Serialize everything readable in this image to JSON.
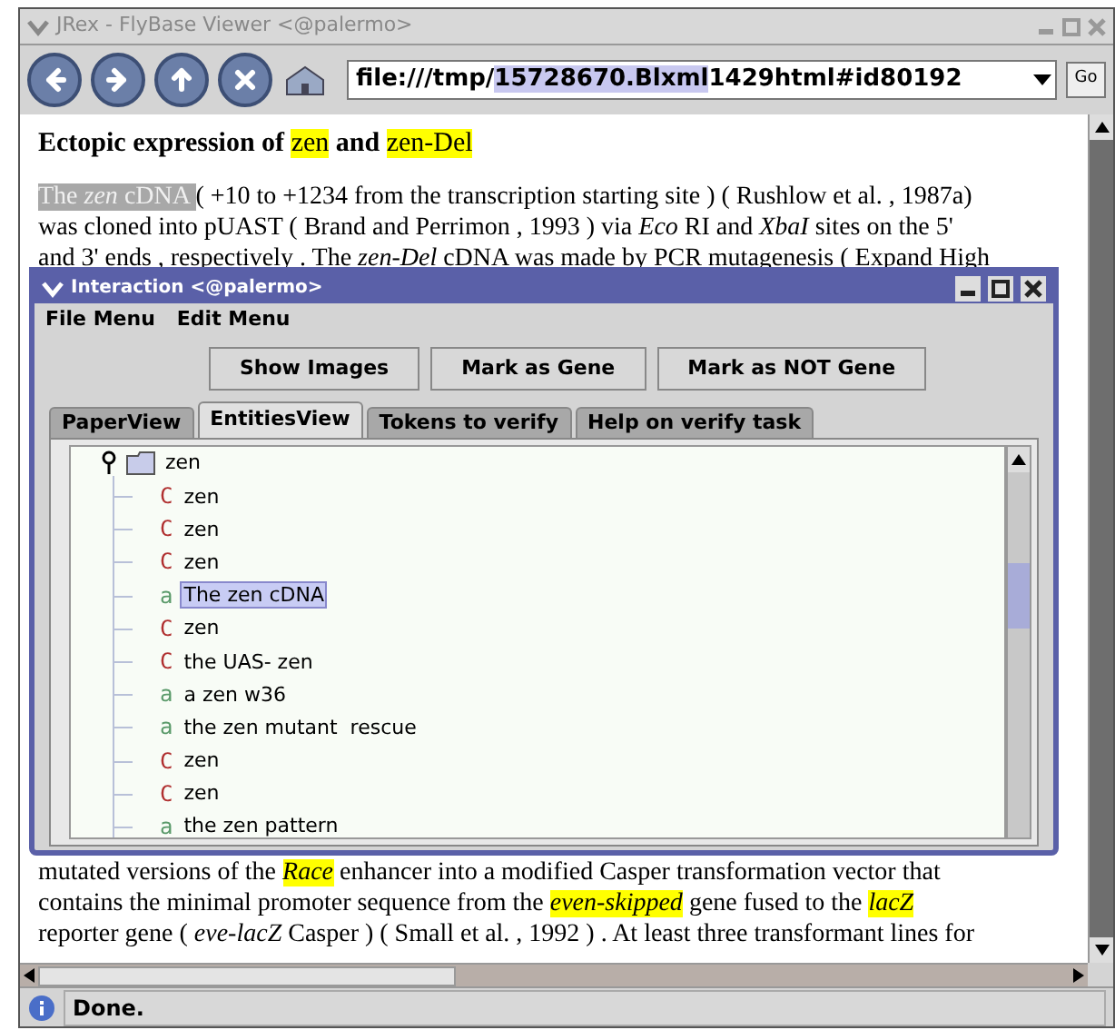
{
  "window": {
    "title": "JRex - FlyBase Viewer <@palermo>"
  },
  "address": {
    "parts": [
      {
        "text": "file:///tmp/",
        "selected": false
      },
      {
        "text": "15728670.Blxml",
        "selected": true
      },
      {
        "text": "1429html#id80192",
        "selected": false
      }
    ],
    "go": "Go"
  },
  "heading": [
    {
      "text": "Ectopic expression of ",
      "bold": true,
      "highlight": false
    },
    {
      "text": "zen",
      "bold": false,
      "highlight": true
    },
    {
      "text": " and ",
      "bold": true,
      "highlight": false
    },
    {
      "text": "zen-Del",
      "bold": false,
      "highlight": true
    }
  ],
  "paragraph_1": [
    [
      {
        "text": "The ",
        "italic": false,
        "highlight": false,
        "selected": true
      },
      {
        "text": "zen",
        "italic": true,
        "highlight": false,
        "selected": true
      },
      {
        "text": " cDNA ",
        "italic": false,
        "highlight": false,
        "selected": true
      },
      {
        "text": "( +10 to +1234 from the transcription starting site ) ( Rushlow et al. , 1987a)",
        "italic": false,
        "highlight": false,
        "selected": false
      }
    ],
    [
      {
        "text": "was cloned into pUAST ( Brand and Perrimon , 1993 ) via ",
        "italic": false,
        "highlight": false,
        "selected": false
      },
      {
        "text": "Eco",
        "italic": true,
        "highlight": false,
        "selected": false
      },
      {
        "text": " RI and ",
        "italic": false,
        "highlight": false,
        "selected": false
      },
      {
        "text": "XbaI",
        "italic": true,
        "highlight": false,
        "selected": false
      },
      {
        "text": " sites on the 5'",
        "italic": false,
        "highlight": false,
        "selected": false
      }
    ],
    [
      {
        "text": "and 3' ends , respectively . The ",
        "italic": false,
        "highlight": false,
        "selected": false
      },
      {
        "text": "zen-Del",
        "italic": true,
        "highlight": false,
        "selected": false
      },
      {
        "text": " cDNA was made by PCR mutagenesis ( Expand High",
        "italic": false,
        "highlight": false,
        "selected": false
      }
    ]
  ],
  "paragraph_2": [
    [
      {
        "text": "mutated versions of the ",
        "italic": false,
        "highlight": false,
        "selected": false
      },
      {
        "text": "Race",
        "italic": true,
        "highlight": true,
        "selected": false
      },
      {
        "text": " enhancer into a modified Casper transformation vector that",
        "italic": false,
        "highlight": false,
        "selected": false
      }
    ],
    [
      {
        "text": "contains the minimal promoter sequence from the ",
        "italic": false,
        "highlight": false,
        "selected": false
      },
      {
        "text": "even-skipped",
        "italic": true,
        "highlight": true,
        "selected": false
      },
      {
        "text": " gene fused to the ",
        "italic": false,
        "highlight": false,
        "selected": false
      },
      {
        "text": "lacZ",
        "italic": true,
        "highlight": true,
        "selected": false
      }
    ],
    [
      {
        "text": "reporter gene ( ",
        "italic": false,
        "highlight": false,
        "selected": false
      },
      {
        "text": "eve-lacZ",
        "italic": true,
        "highlight": false,
        "selected": false
      },
      {
        "text": " Casper ) ( Small et al. , 1992 ) . At least three transformant lines for",
        "italic": false,
        "highlight": false,
        "selected": false
      }
    ]
  ],
  "status_bar": "Done.",
  "dialog": {
    "title": "Interaction <@palermo>",
    "menus": [
      "File Menu",
      "Edit Menu"
    ],
    "buttons": [
      "Show Images",
      "Mark as Gene",
      "Mark as NOT Gene"
    ],
    "tabs": [
      {
        "label": "PaperView",
        "selected": false
      },
      {
        "label": "EntitiesView",
        "selected": true
      },
      {
        "label": "Tokens to verify",
        "selected": false
      },
      {
        "label": "Help on verify task",
        "selected": false
      }
    ],
    "tree": {
      "label": "zen",
      "expanded": true,
      "children": [
        {
          "label": "zen",
          "kind": "c",
          "glyph": "C",
          "selected": false
        },
        {
          "label": "zen",
          "kind": "c",
          "glyph": "C",
          "selected": false
        },
        {
          "label": "zen",
          "kind": "c",
          "glyph": "C",
          "selected": false
        },
        {
          "label": "The zen cDNA",
          "kind": "a",
          "glyph": "a",
          "selected": true
        },
        {
          "label": "zen",
          "kind": "c",
          "glyph": "C",
          "selected": false
        },
        {
          "label": "the UAS- zen",
          "kind": "c",
          "glyph": "C",
          "selected": false
        },
        {
          "label": "a zen w36",
          "kind": "a",
          "glyph": "a",
          "selected": false
        },
        {
          "label": "the zen mutant  rescue",
          "kind": "a",
          "glyph": "a",
          "selected": false
        },
        {
          "label": "zen",
          "kind": "c",
          "glyph": "C",
          "selected": false
        },
        {
          "label": "zen",
          "kind": "c",
          "glyph": "C",
          "selected": false
        },
        {
          "label": "the zen pattern",
          "kind": "a",
          "glyph": "a",
          "selected": false
        }
      ]
    }
  }
}
